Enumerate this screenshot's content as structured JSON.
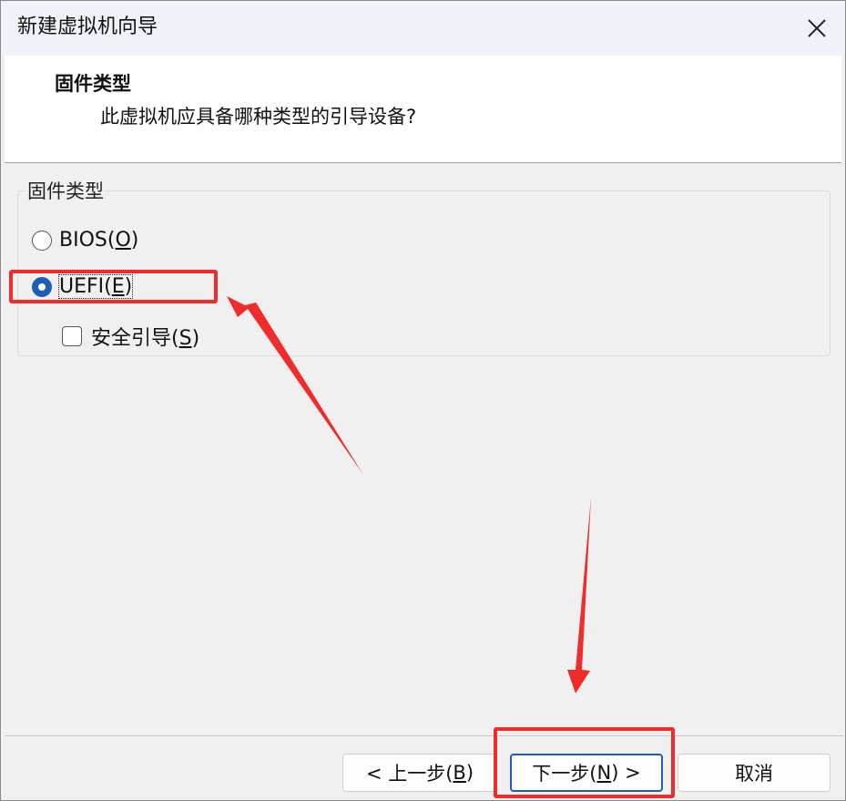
{
  "window": {
    "title": "新建虚拟机向导"
  },
  "header": {
    "title": "固件类型",
    "subtitle": "此虚拟机应具备哪种类型的引导设备?"
  },
  "firmware_group": {
    "label": "固件类型",
    "options": [
      {
        "label": "BIOS(",
        "mnemonic": "O",
        "suffix": ")",
        "checked": false
      },
      {
        "label": "UEFI(",
        "mnemonic": "E",
        "suffix": ")",
        "checked": true
      }
    ],
    "secure_boot": {
      "label": "安全引导(",
      "mnemonic": "S",
      "suffix": ")",
      "checked": false
    }
  },
  "buttons": {
    "back": {
      "prefix": "< 上一步(",
      "mnemonic": "B",
      "suffix": ")"
    },
    "next": {
      "prefix": "下一步(",
      "mnemonic": "N",
      "suffix": ") >"
    },
    "cancel": {
      "label": "取消"
    }
  },
  "annotation_color": "#ef2b2b",
  "accent_color": "#1d5fb4"
}
